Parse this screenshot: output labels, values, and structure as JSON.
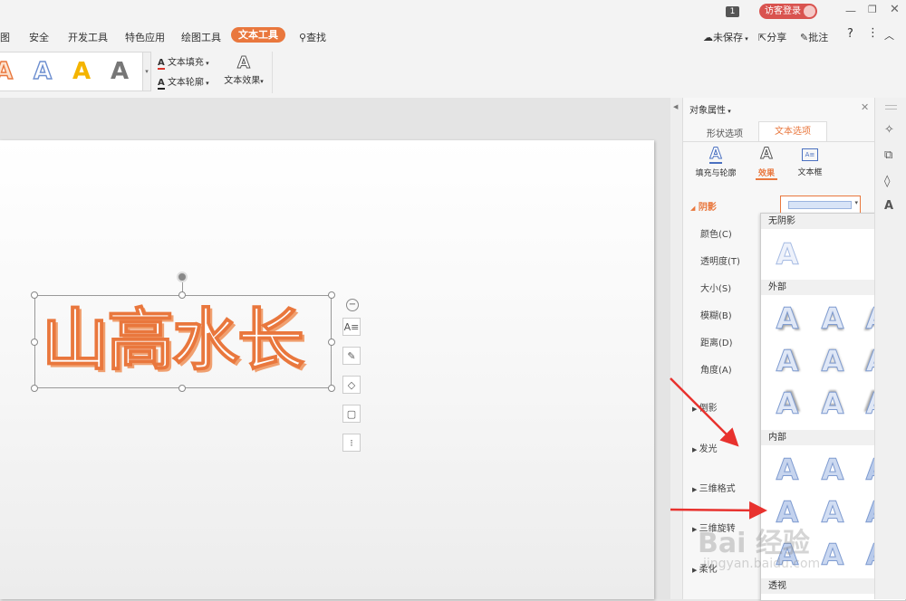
{
  "titlebar": {
    "page_badge": "1",
    "login_label": "访客登录"
  },
  "tabs": [
    "图",
    "安全",
    "开发工具",
    "特色应用",
    "绘图工具",
    "文本工具",
    "查找"
  ],
  "active_tab": "文本工具",
  "topright": {
    "save_label": "未保存",
    "share_label": "分享",
    "comment_label": "批注",
    "help": "?"
  },
  "ribbon": {
    "fill_label": "文本填充",
    "outline_label": "文本轮廓",
    "effect_label": "文本效果",
    "style_letter": "A"
  },
  "slide": {
    "text": "山高水长"
  },
  "panel": {
    "title": "对象属性",
    "tab_shape": "形状选项",
    "tab_text": "文本选项",
    "sub_fill": "填充与轮廓",
    "sub_effect": "效果",
    "sub_textbox": "文本框",
    "shadow_label": "阴影",
    "props": [
      "颜色(C)",
      "透明度(T)",
      "大小(S)",
      "模糊(B)",
      "距离(D)",
      "角度(A)"
    ],
    "sections": [
      "倒影",
      "发光",
      "三维格式",
      "三维旋转",
      "柔化"
    ]
  },
  "dropdown": {
    "no_shadow": "无阴影",
    "outer": "外部",
    "inner": "内部",
    "perspective": "透视",
    "letter": "A"
  },
  "watermark": {
    "brand": "Bai 经验",
    "url": "jingyan.baidu.com"
  },
  "colors": {
    "accent": "#e9773d",
    "login_bg": "#d9534f",
    "arrow": "#e8322e"
  }
}
